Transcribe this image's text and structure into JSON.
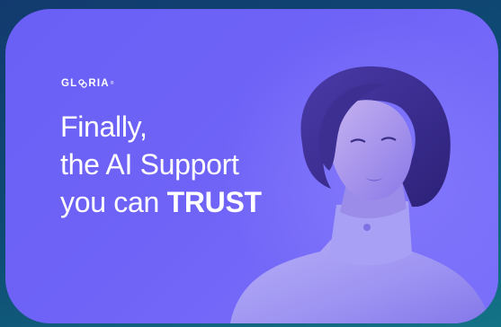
{
  "brand": {
    "name_prefix": "GL",
    "name_suffix": "RIA",
    "trademark": "®"
  },
  "headline": {
    "line1": "Finally,",
    "line2": "the AI Support",
    "line3_prefix": "you can ",
    "line3_emphasis": "TRUST"
  },
  "colors": {
    "background": "#0e4a74",
    "card": "#6f63f7",
    "text": "#ffffff"
  },
  "icons": {
    "logo_mark": "gloria-o-knot-icon"
  }
}
